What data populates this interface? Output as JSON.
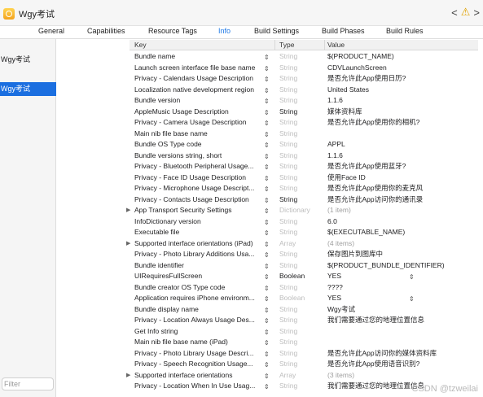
{
  "window": {
    "target_name": "Wgy考试",
    "nav_left": "<",
    "nav_right": ">",
    "warning_glyph": "⚠"
  },
  "tabs": [
    {
      "label": "General"
    },
    {
      "label": "Capabilities"
    },
    {
      "label": "Resource Tags"
    },
    {
      "label": "Info"
    },
    {
      "label": "Build Settings"
    },
    {
      "label": "Build Phases"
    },
    {
      "label": "Build Rules"
    }
  ],
  "sidebar": {
    "items": [
      {
        "label": "Wgy考试"
      },
      {
        "label": "Wgy考试"
      }
    ],
    "filter_placeholder": "Filter"
  },
  "plist": {
    "columns": {
      "key": "Key",
      "type": "Type",
      "value": "Value"
    },
    "rows": [
      {
        "key": "Bundle name",
        "type": "String",
        "value": "$(PRODUCT_NAME)"
      },
      {
        "key": "Launch screen interface file base name",
        "type": "String",
        "value": "CDVLaunchScreen"
      },
      {
        "key": "Privacy - Calendars Usage Description",
        "type": "String",
        "value": "是否允许此App使用日历?"
      },
      {
        "key": "Localization native development region",
        "type": "String",
        "value": "United States"
      },
      {
        "key": "Bundle version",
        "type": "String",
        "value": "1.1.6"
      },
      {
        "key": "AppleMusic Usage Description",
        "type": "String",
        "value": "媒体资料库"
      },
      {
        "key": "Privacy - Camera Usage Description",
        "type": "String",
        "value": "是否允许此App使用你的相机?"
      },
      {
        "key": "Main nib file base name",
        "type": "String",
        "value": ""
      },
      {
        "key": "Bundle OS Type code",
        "type": "String",
        "value": "APPL"
      },
      {
        "key": "Bundle versions string, short",
        "type": "String",
        "value": "1.1.6"
      },
      {
        "key": "Privacy - Bluetooth Peripheral Usage...",
        "type": "String",
        "value": "是否允许此App使用蓝牙?"
      },
      {
        "key": "Privacy - Face ID Usage Description",
        "type": "String",
        "value": "使用Face ID"
      },
      {
        "key": "Privacy - Microphone Usage Descript...",
        "type": "String",
        "value": "是否允许此App使用你的麦克风"
      },
      {
        "key": "Privacy - Contacts Usage Description",
        "type": "String",
        "value": "是否允许此App访问你的通讯录"
      },
      {
        "key": "App Transport Security Settings",
        "type": "Dictionary",
        "value": "(1 item)"
      },
      {
        "key": "InfoDictionary version",
        "type": "String",
        "value": "6.0"
      },
      {
        "key": "Executable file",
        "type": "String",
        "value": "$(EXECUTABLE_NAME)"
      },
      {
        "key": "Supported interface orientations (iPad)",
        "type": "Array",
        "value": "(4 items)"
      },
      {
        "key": "Privacy - Photo Library Additions Usa...",
        "type": "String",
        "value": "保存图片到图库中"
      },
      {
        "key": "Bundle identifier",
        "type": "String",
        "value": "$(PRODUCT_BUNDLE_IDENTIFIER)"
      },
      {
        "key": "UIRequiresFullScreen",
        "type": "Boolean",
        "value": "YES"
      },
      {
        "key": "Bundle creator OS Type code",
        "type": "String",
        "value": "????"
      },
      {
        "key": "Application requires iPhone environm...",
        "type": "Boolean",
        "value": "YES"
      },
      {
        "key": "Bundle display name",
        "type": "String",
        "value": "Wgy考试"
      },
      {
        "key": "Privacy - Location Always Usage Des...",
        "type": "String",
        "value": "我们需要通过您的地理位置信息"
      },
      {
        "key": "Get Info string",
        "type": "String",
        "value": ""
      },
      {
        "key": "Main nib file base name (iPad)",
        "type": "String",
        "value": ""
      },
      {
        "key": "Privacy - Photo Library Usage Descri...",
        "type": "String",
        "value": "是否允许此App访问你的媒体资料库"
      },
      {
        "key": "Privacy - Speech Recognition Usage...",
        "type": "String",
        "value": "是否允许此App使用语音识别?"
      },
      {
        "key": "Supported interface orientations",
        "type": "Array",
        "value": "(3 items)"
      },
      {
        "key": "Privacy - Location When In Use Usag...",
        "type": "String",
        "value": "我们需要通过您的地理位置信息"
      }
    ]
  },
  "watermark": "CSDN @tzweilai"
}
